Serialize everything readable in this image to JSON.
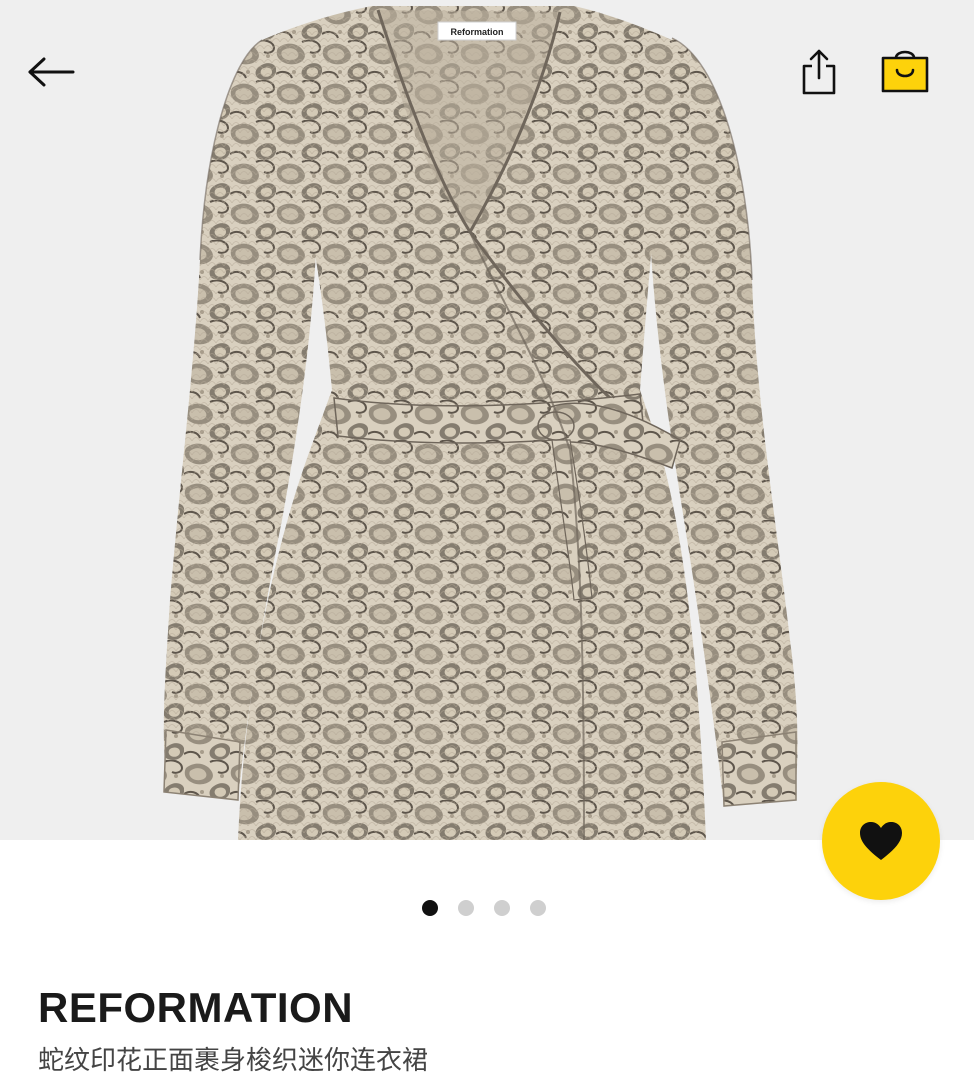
{
  "header": {
    "back_icon": "arrow-left-icon",
    "share_icon": "share-icon",
    "bag_icon": "shopping-bag-icon"
  },
  "product_image": {
    "garment_label_text": "Reformation",
    "pattern": "snakeskin print wrap mini dress"
  },
  "favorite": {
    "icon": "heart-icon",
    "accent_color": "#FDD20B"
  },
  "gallery": {
    "total_images": 4,
    "current_index": 0
  },
  "product": {
    "brand": "REFORMATION",
    "name": "蛇纹印花正面裹身梭织迷你连衣裙"
  },
  "colors": {
    "accent": "#FDD20B",
    "text_primary": "#1a1a1a",
    "text_secondary": "#444444",
    "dot_active": "#111111",
    "dot_inactive": "#cfcfcf"
  }
}
